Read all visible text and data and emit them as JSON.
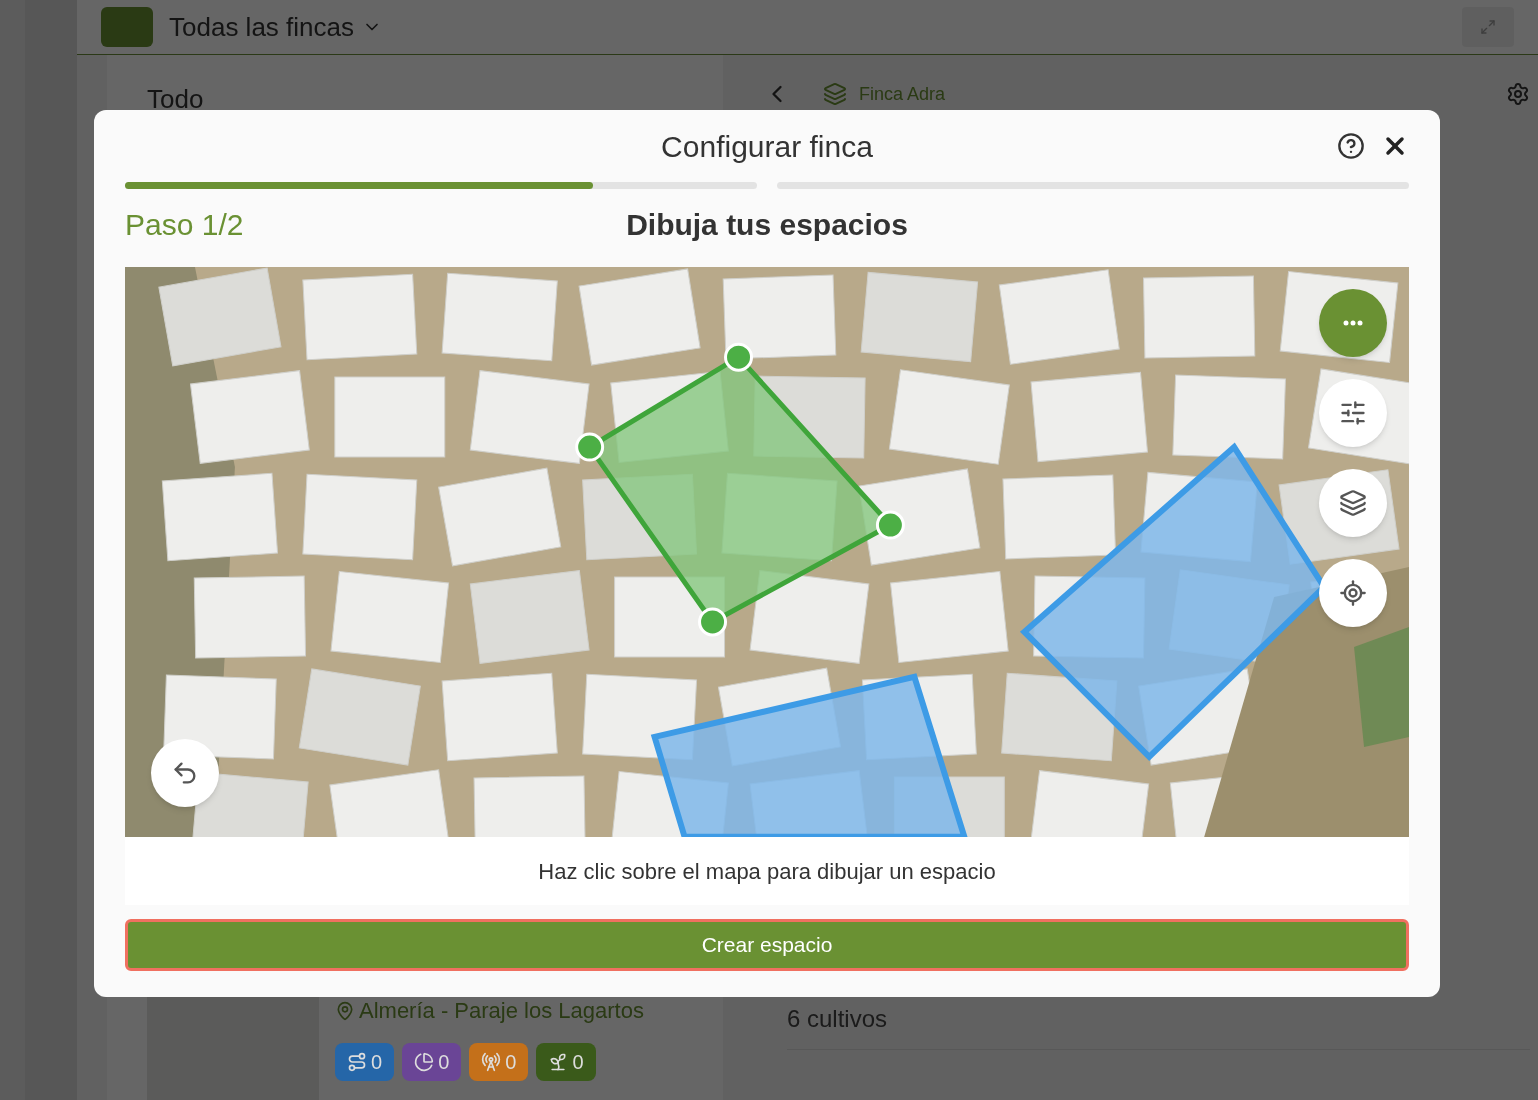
{
  "app_header": {
    "title": "Todas las fincas"
  },
  "left_panel": {
    "title": "Todo",
    "farm_location": "Almería - Paraje los Lagartos",
    "counters": [
      {
        "kind": "spaces",
        "value": "0",
        "color": "#2566a8"
      },
      {
        "kind": "charts",
        "value": "0",
        "color": "#6a4596"
      },
      {
        "kind": "sensors",
        "value": "0",
        "color": "#c4701a"
      },
      {
        "kind": "crops",
        "value": "0",
        "color": "#3a5a1a"
      }
    ]
  },
  "right_panel": {
    "farm_name": "Finca Adra",
    "crops_count": "6 cultivos"
  },
  "modal": {
    "title": "Configurar finca",
    "current_step_progress": {
      "level": 0.74
    },
    "step_label": "Paso 1/2",
    "heading": "Dibuja tus espacios",
    "map_controls": [
      {
        "kind": "more",
        "selected": true
      },
      {
        "kind": "filters",
        "selected": false
      },
      {
        "kind": "layers",
        "selected": false
      },
      {
        "kind": "locate",
        "selected": false
      }
    ],
    "hint": "Haz clic sobre el mapa para dibujar un espacio",
    "primary_button": "Crear espacio"
  }
}
